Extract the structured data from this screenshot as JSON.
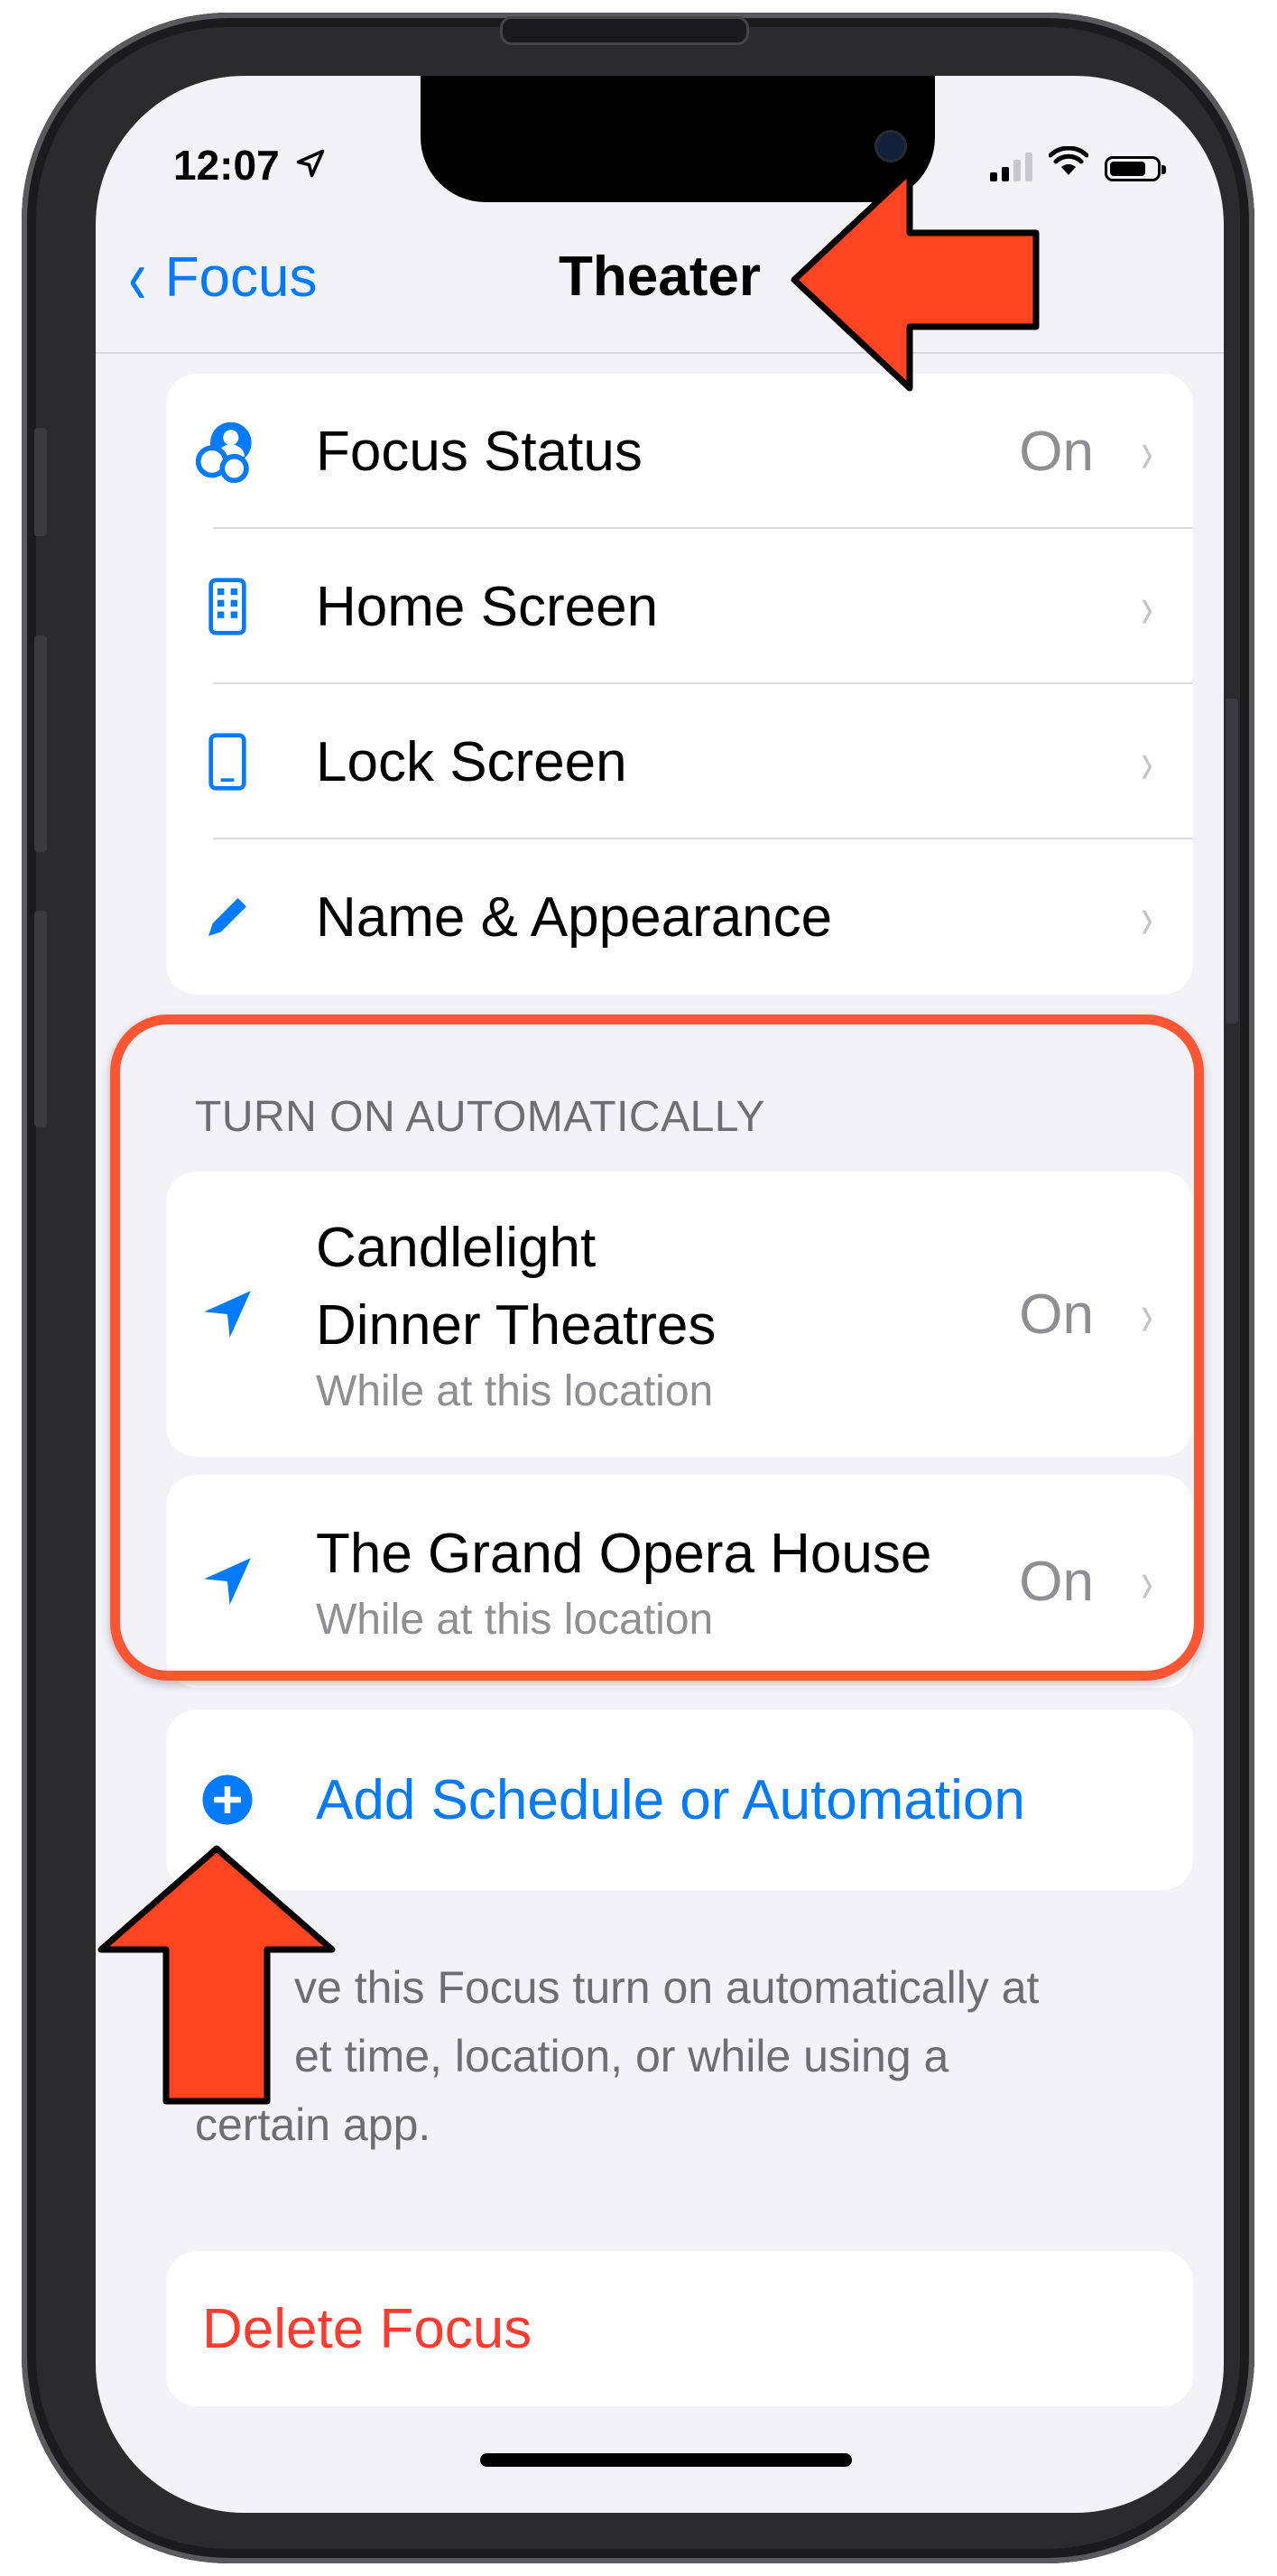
{
  "status_bar": {
    "time": "12:07",
    "location_glyph": "➤"
  },
  "nav": {
    "back_label": "Focus",
    "title": "Theater"
  },
  "settings": [
    {
      "icon": "focus-status-icon",
      "label": "Focus Status",
      "value": "On"
    },
    {
      "icon": "home-screen-icon",
      "label": "Home Screen",
      "value": ""
    },
    {
      "icon": "lock-screen-icon",
      "label": "Lock Screen",
      "value": ""
    },
    {
      "icon": "pencil-icon",
      "label": "Name & Appearance",
      "value": ""
    }
  ],
  "automation": {
    "header": "TURN ON AUTOMATICALLY",
    "items": [
      {
        "icon": "location-arrow-icon",
        "title_line1": "Candlelight",
        "title_line2": "Dinner Theatres",
        "subtitle": "While at this location",
        "value": "On"
      },
      {
        "icon": "location-arrow-icon",
        "title": "The Grand Opera House",
        "subtitle": "While at this location",
        "value": "On"
      }
    ]
  },
  "add_automation": {
    "icon": "plus-circle-icon",
    "label": "Add Schedule or Automation"
  },
  "footer": {
    "line1": "ve this Focus turn on automatically at",
    "line2": "et time, location, or while using a",
    "line3": "certain app."
  },
  "delete": {
    "label": "Delete Focus"
  },
  "colors": {
    "accent": "#007aff",
    "destructive": "#ff3b30",
    "annotation": "#ff5533",
    "background": "#f2f2f7"
  }
}
